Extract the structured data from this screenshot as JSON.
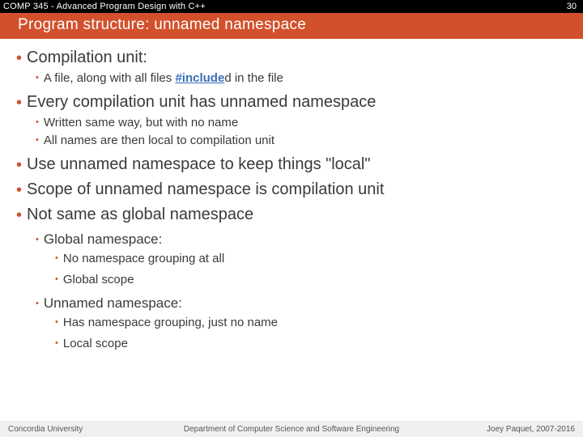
{
  "topbar": {
    "course": "COMP 345 - Advanced Program Design with C++",
    "page": "30"
  },
  "title": "Program structure: unnamed namespace",
  "bullets": {
    "compUnit": "Compilation unit:",
    "compUnit_a_pre": "A file, along with all files ",
    "compUnit_a_kw": "#include",
    "compUnit_a_post": "d in the file",
    "every": "Every compilation unit has unnamed namespace",
    "every_a": "Written same way, but with no name",
    "every_b": "All names are then local to compilation unit",
    "use": "Use unnamed namespace to keep things \"local\"",
    "scope": "Scope of unnamed namespace is compilation unit",
    "notsame": "Not same as global namespace",
    "global": "Global namespace:",
    "global_a": "No namespace grouping at all",
    "global_b": "Global scope",
    "unnamed": "Unnamed namespace:",
    "unnamed_a": "Has namespace grouping, just no name",
    "unnamed_b": "Local scope"
  },
  "footer": {
    "left": "Concordia University",
    "mid": "Department of Computer Science and Software Engineering",
    "right": "Joey Paquet, 2007-2016"
  }
}
